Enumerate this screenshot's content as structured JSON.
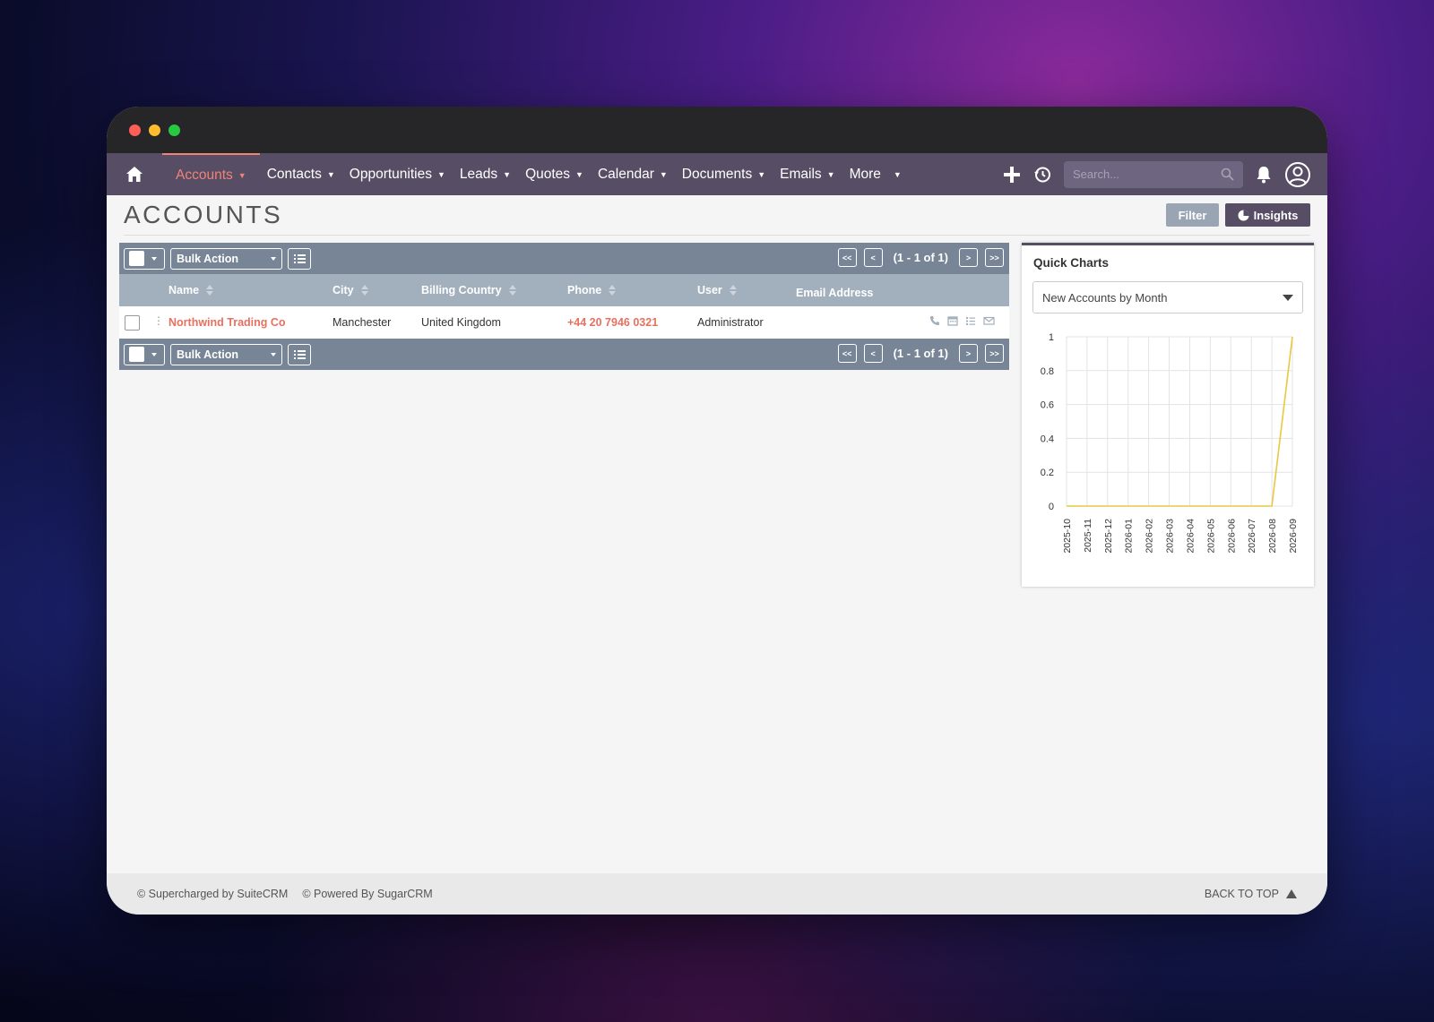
{
  "nav": {
    "items": [
      {
        "label": "Accounts",
        "active": true
      },
      {
        "label": "Contacts"
      },
      {
        "label": "Opportunities"
      },
      {
        "label": "Leads"
      },
      {
        "label": "Quotes"
      },
      {
        "label": "Calendar"
      },
      {
        "label": "Documents"
      },
      {
        "label": "Emails"
      },
      {
        "label": "More"
      }
    ],
    "search_placeholder": "Search...",
    "accent_color": "#f08377",
    "bar_color": "#574e65"
  },
  "page": {
    "title": "ACCOUNTS",
    "filter_label": "Filter",
    "insights_label": "Insights"
  },
  "list": {
    "bulk_action_label": "Bulk Action",
    "pagination": "(1 - 1 of 1)",
    "pager_first": "<<",
    "pager_prev": "<",
    "pager_next": ">",
    "pager_last": ">>",
    "columns": [
      "Name",
      "City",
      "Billing Country",
      "Phone",
      "User",
      "Email Address"
    ],
    "rows": [
      {
        "name": "Northwind Trading Co",
        "city": "Manchester",
        "billing_country": "United Kingdom",
        "phone": "+44 20 7946 0321",
        "user": "Administrator",
        "email": ""
      }
    ]
  },
  "quick_charts": {
    "title": "Quick Charts",
    "selected": "New Accounts by Month"
  },
  "chart_data": {
    "type": "line",
    "x": [
      "2025-10",
      "2025-11",
      "2025-12",
      "2026-01",
      "2026-02",
      "2026-03",
      "2026-04",
      "2026-05",
      "2026-06",
      "2026-07",
      "2026-08",
      "2026-09"
    ],
    "values": [
      0,
      0,
      0,
      0,
      0,
      0,
      0,
      0,
      0,
      0,
      0,
      1
    ],
    "yticks": [
      "0",
      "0.2",
      "0.4",
      "0.6",
      "0.8",
      "1"
    ],
    "ylim": [
      0,
      1
    ],
    "grid": true,
    "line_color": "#e8c840"
  },
  "footer": {
    "supercharged": "© Supercharged by SuiteCRM",
    "powered": "© Powered By SugarCRM",
    "back_to_top": "BACK TO TOP"
  }
}
